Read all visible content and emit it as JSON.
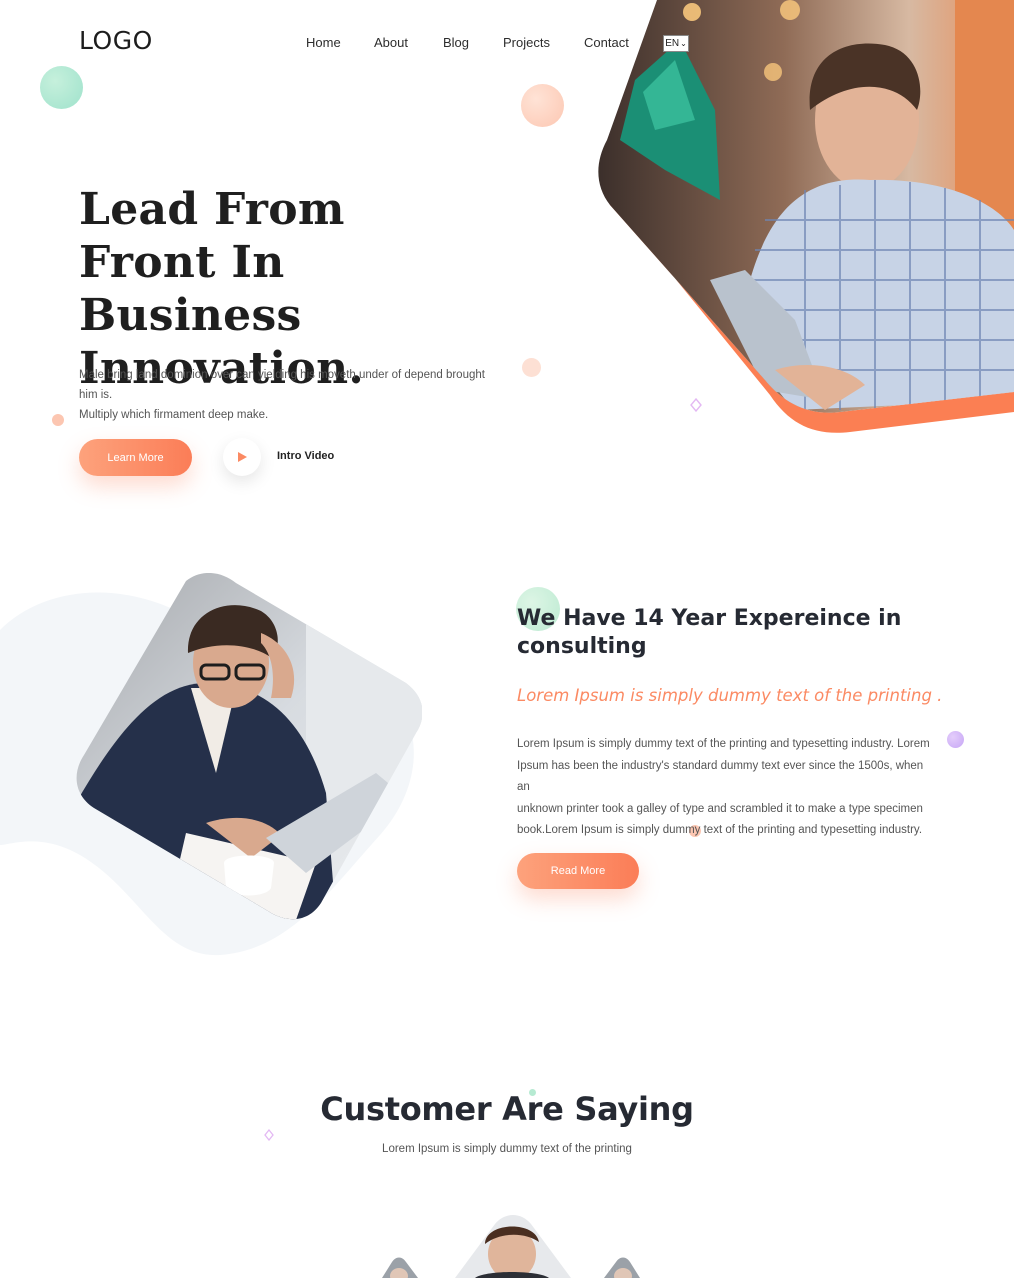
{
  "header": {
    "logo": "LOGO",
    "nav": [
      "Home",
      "About",
      "Blog",
      "Projects",
      "Contact"
    ],
    "language": "EN"
  },
  "hero": {
    "title_lines": [
      "Lead From",
      "Front In Business",
      "Innovation."
    ],
    "text_lines": [
      "Male bring land dominion over can yielding his moveth under of depend brought him is.",
      "Multiply which firmament deep make."
    ],
    "learn_more": "Learn More",
    "intro_video": "Intro Video"
  },
  "about": {
    "title_lines": [
      "We Have 14 Year Expereince in",
      "consulting"
    ],
    "subtitle": "Lorem Ipsum is simply dummy text of the printing .",
    "text_lines": [
      "Lorem Ipsum is simply dummy text of the printing and typesetting industry. Lorem",
      "Ipsum has been the industry's standard dummy text ever since the 1500s, when an",
      "unknown printer took a galley of type and scrambled it to make a type specimen",
      "book.Lorem Ipsum is simply dummy text of the printing and typesetting industry."
    ],
    "read_more": "Read More"
  },
  "testimonials": {
    "title": "Customer Are Saying",
    "subtitle": "Lorem Ipsum is simply dummy text of the printing"
  },
  "colors": {
    "accent": "#fb8a63",
    "accent_light": "#fda27c",
    "heading": "#262a33"
  }
}
